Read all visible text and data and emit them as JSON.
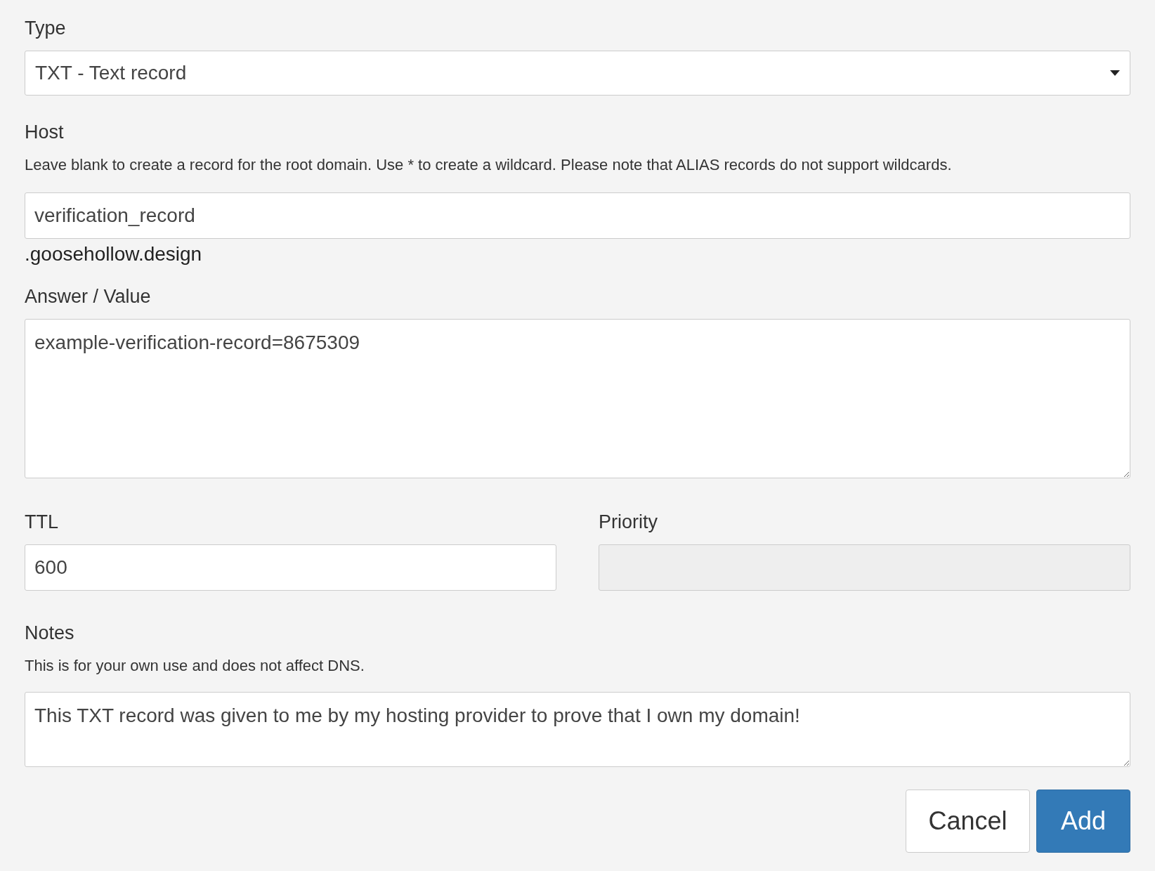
{
  "fields": [
    {
      "kind": "select",
      "label": "Type",
      "value": "TXT - Text record"
    },
    {
      "kind": "text",
      "label": "Host",
      "help": "Leave blank to create a record for the root domain. Use * to create a wildcard. Please note that ALIAS records do not support wildcards.",
      "value": "verification_record",
      "suffix": ".goosehollow.design"
    },
    {
      "kind": "textarea",
      "label": "Answer / Value",
      "value": "example-verification-record=8675309"
    }
  ],
  "pair": [
    {
      "label": "TTL",
      "value": "600",
      "disabled": false
    },
    {
      "label": "Priority",
      "disabled": true
    }
  ],
  "notes": {
    "label": "Notes",
    "help": "This is for your own use and does not affect DNS.",
    "value": "This TXT record was given to me by my hosting provider to prove that I own my domain!"
  },
  "buttons": [
    {
      "label": "Cancel",
      "kind": "secondary"
    },
    {
      "label": "Add",
      "kind": "primary"
    }
  ]
}
